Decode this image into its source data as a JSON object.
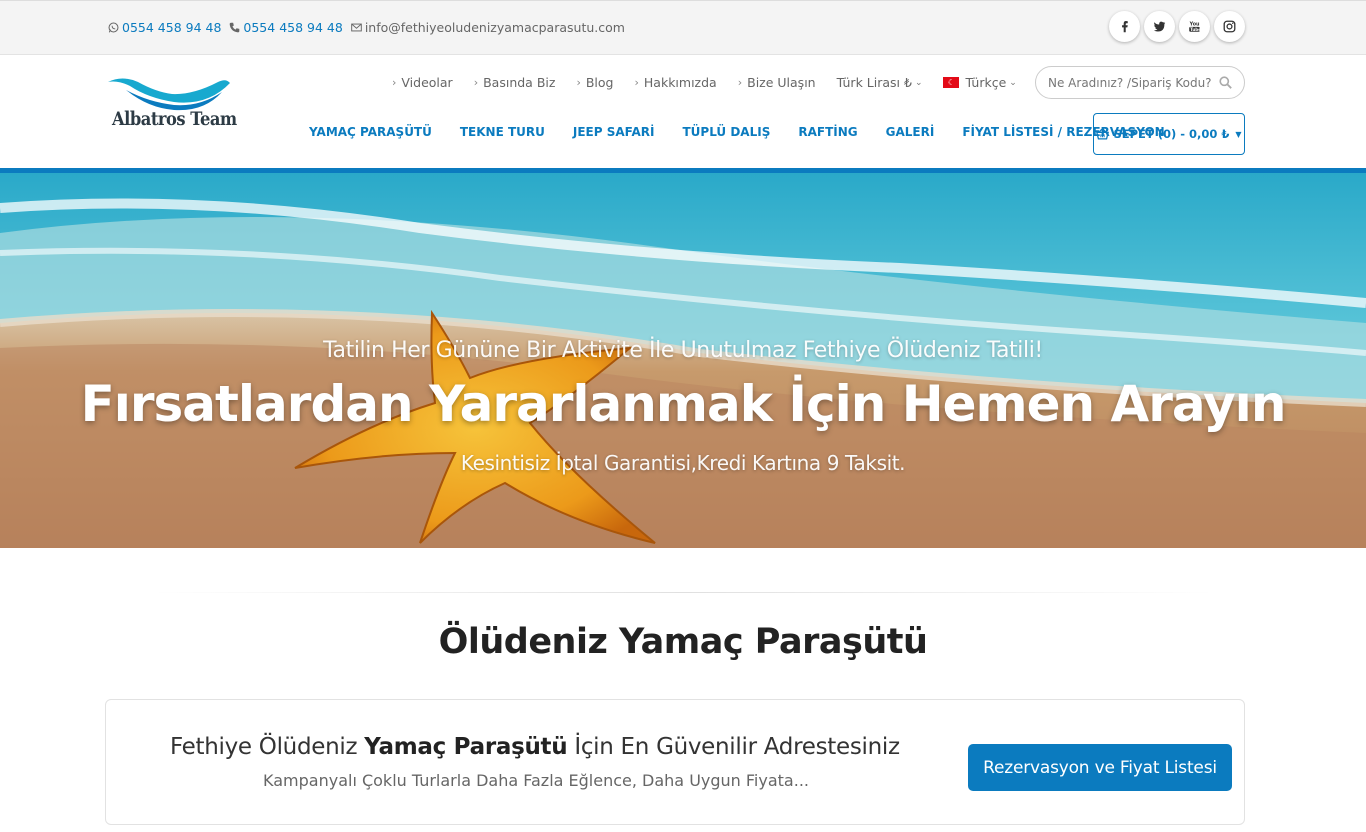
{
  "topbar": {
    "whatsapp": "0554 458 94 48",
    "phone": "0554 458 94 48",
    "email": "info@fethiyeoludenizyamacparasutu.com",
    "social": [
      {
        "icon": "facebook-icon",
        "glyph": "f"
      },
      {
        "icon": "twitter-icon",
        "glyph": ""
      },
      {
        "icon": "youtube-icon",
        "glyph": ""
      },
      {
        "icon": "instagram-icon",
        "glyph": ""
      }
    ]
  },
  "header": {
    "logo_text": "Albatros Team",
    "util_nav": [
      "Videolar",
      "Basında Biz",
      "Blog",
      "Hakkımızda",
      "Bize Ulaşın"
    ],
    "currency": "Türk Lirası ₺",
    "language": "Türkçe",
    "search_placeholder": "Ne Aradınız? /Sipariş Kodu?",
    "main_nav": [
      "YAMAÇ PARAŞÜTÜ",
      "TEKNE TURU",
      "JEEP SAFARİ",
      "TÜPLÜ DALIŞ",
      "RAFTİNG",
      "GALERİ",
      "FİYAT LİSTESİ / REZERVASYON"
    ],
    "cart_label": "SEPET (0) - 0,00 ₺"
  },
  "hero": {
    "subtitle": "Tatilin Her Gününe Bir Aktivite İle Unutulmaz Fethiye Ölüdeniz Tatili!",
    "title": "Fırsatlardan Yararlanmak İçin Hemen Arayın",
    "tagline": "Kesintisiz İptal Garantisi,Kredi Kartına 9 Taksit."
  },
  "section": {
    "title": "Ölüdeniz Yamaç Paraşütü",
    "cta_prefix": "Fethiye Ölüdeniz ",
    "cta_bold": "Yamaç Paraşütü",
    "cta_suffix": " İçin En Güvenilir Adrestesiniz",
    "cta_sub": "Kampanyalı Çoklu Turlarla Daha Fazla Eğlence, Daha Uygun Fiyata...",
    "cta_button": "Rezervasyon ve Fiyat Listesi"
  },
  "colors": {
    "accent": "#0b7bbf",
    "topbar_bg": "#f4f4f4"
  }
}
